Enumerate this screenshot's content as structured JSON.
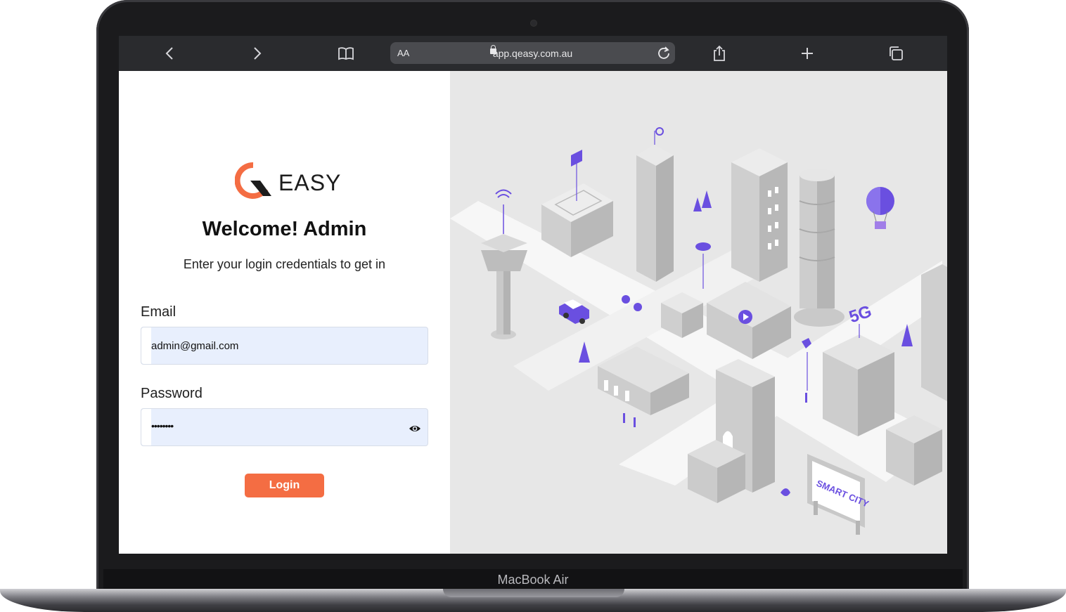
{
  "device": {
    "label": "MacBook Air"
  },
  "browser": {
    "back_icon": "chevron-left-icon",
    "forward_icon": "chevron-right-icon",
    "bookmarks_icon": "book-icon",
    "text_size_label": "AA",
    "url": "app.qeasy.com.au",
    "reload_icon": "reload-icon",
    "share_icon": "share-icon",
    "new_tab_icon": "plus-icon",
    "tabs_icon": "tabs-icon"
  },
  "login": {
    "logo_text": "EASY",
    "title": "Welcome! Admin",
    "subtitle": "Enter your login credentials to get in",
    "email_label": "Email",
    "email_value": "admin@gmail.com",
    "password_label": "Password",
    "password_value": "••••••••",
    "show_password_icon": "eye-icon",
    "login_button": "Login"
  },
  "illustration": {
    "label_5g": "5G",
    "sign_text": "SMART CITY"
  },
  "colors": {
    "accent": "#f46d43",
    "illustration_accent": "#6a4fe0",
    "input_bg": "#e8effd",
    "browser_toolbar": "#2a2b2e"
  }
}
